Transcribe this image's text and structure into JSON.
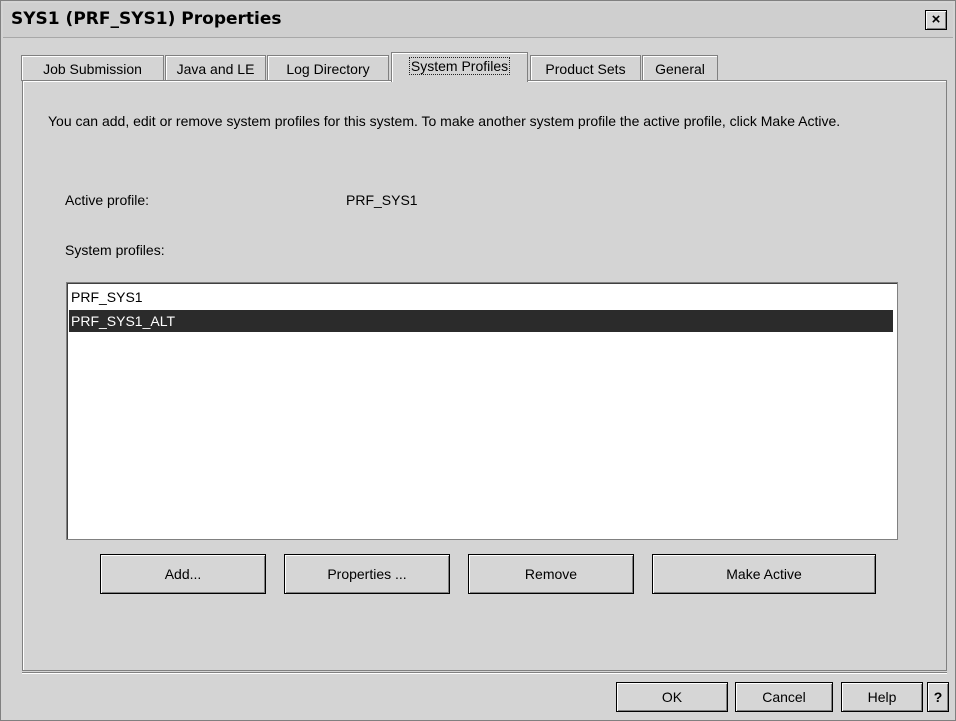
{
  "window": {
    "title": "SYS1 (PRF_SYS1) Properties",
    "close_label": "×"
  },
  "tabs": [
    {
      "label": "Job Submission"
    },
    {
      "label": "Java and LE"
    },
    {
      "label": "Log Directory"
    },
    {
      "label": "System Profiles"
    },
    {
      "label": "Product Sets"
    },
    {
      "label": "General"
    }
  ],
  "active_tab": "System Profiles",
  "panel": {
    "description": "You can add, edit or remove system profiles for this system. To make another system profile the active profile, click Make Active.",
    "active_profile_label": "Active profile:",
    "active_profile_value": "PRF_SYS1",
    "system_profiles_label": "System profiles:",
    "profiles": [
      {
        "name": "PRF_SYS1",
        "selected": false
      },
      {
        "name": "PRF_SYS1_ALT",
        "selected": true
      }
    ],
    "buttons": {
      "add": "Add...",
      "properties": "Properties ...",
      "remove": "Remove",
      "make_active": "Make Active"
    }
  },
  "footer": {
    "ok": "OK",
    "cancel": "Cancel",
    "help": "Help",
    "context_help": "?"
  },
  "colors": {
    "dialog_bg": "#d4d4d4",
    "selection_bg": "#2b2b2b",
    "selection_fg": "#ffffff"
  }
}
